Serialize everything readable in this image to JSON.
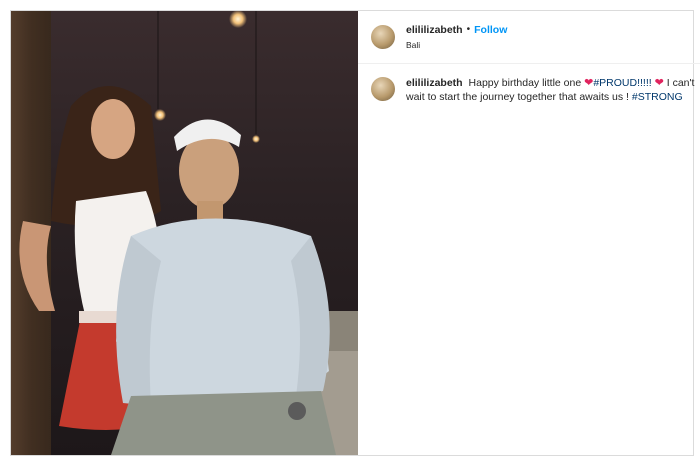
{
  "post": {
    "username": "elililizabeth",
    "separator": "•",
    "follow_label": "Follow",
    "location": "Bali",
    "caption": {
      "username": "elililizabeth",
      "text_1": "Happy birthday little one",
      "heart_1": "❤",
      "hashtag_1": "#PROUD!!!!!",
      "heart_2": "❤",
      "text_2": "I can't wait to start the journey together that awaits us !",
      "hashtag_2": "#STRONG"
    }
  },
  "colors": {
    "accent": "#0095f6",
    "hashtag": "#00376b",
    "heart": "#e0245e"
  }
}
